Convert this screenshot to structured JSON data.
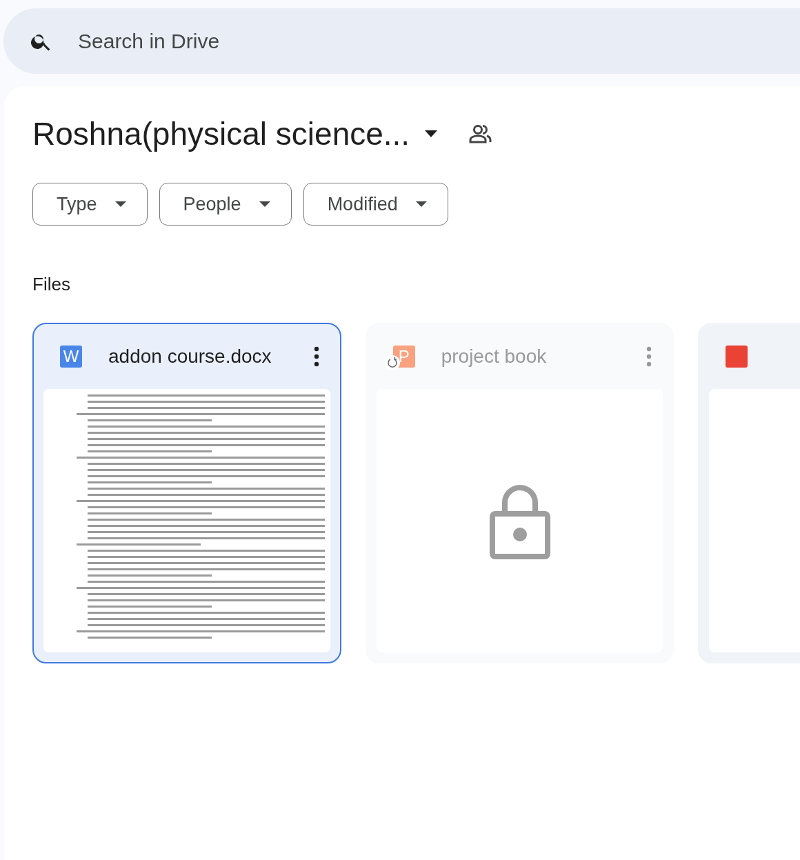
{
  "search": {
    "placeholder": "Search in Drive"
  },
  "folder": {
    "title": "Roshna(physical science..."
  },
  "filters": [
    {
      "label": "Type"
    },
    {
      "label": "People"
    },
    {
      "label": "Modified"
    }
  ],
  "files_heading": "Files",
  "files": [
    {
      "name": "addon course.docx",
      "badge": "W",
      "color": "#4a86e8",
      "selected": true,
      "unavailable": false,
      "kind": "document"
    },
    {
      "name": "project book",
      "badge": "P",
      "color": "#f9a27f",
      "selected": false,
      "unavailable": true,
      "kind": "locked"
    },
    {
      "color": "#ea4335",
      "selected": false,
      "unavailable": false,
      "kind": "blank"
    }
  ]
}
